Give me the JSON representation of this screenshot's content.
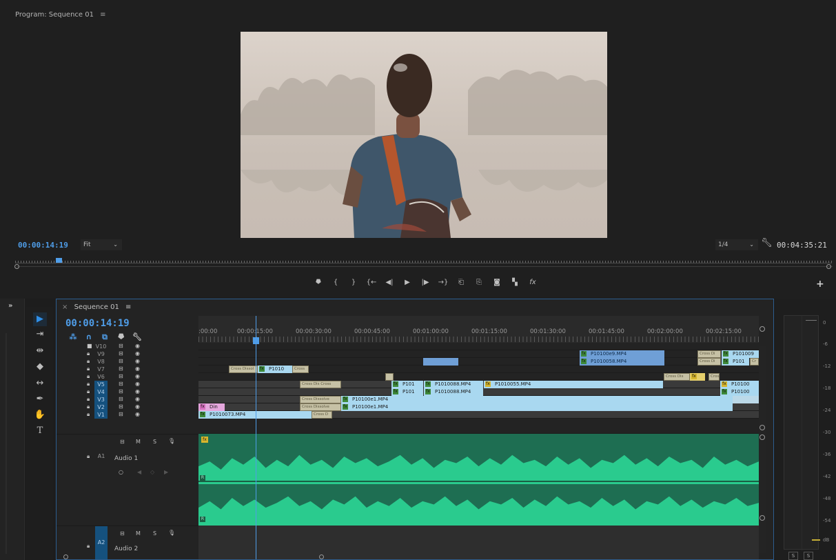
{
  "program": {
    "title": "Program: Sequence 01",
    "menu_icon": "≡",
    "current_timecode": "00:00:14:19",
    "fit": "Fit",
    "resolution": "1/4",
    "duration": "00:04:35:21",
    "transport_icons": [
      "marker-icon",
      "in-icon",
      "out-icon",
      "go-to-in-icon",
      "step-back-icon",
      "play-icon",
      "step-forward-icon",
      "go-to-out-icon",
      "lift-icon",
      "extract-icon",
      "camera-icon",
      "compare-icon",
      "fx-icon"
    ],
    "transport_glyphs": [
      "⯂",
      "{",
      "}",
      "{←",
      "◀|",
      "▶",
      "|▶",
      "→}",
      "⎗",
      "⎘",
      "◙",
      "▚",
      "fx"
    ],
    "add_button": "+"
  },
  "timeline": {
    "tab_close": "×",
    "tab_label": "Sequence 01",
    "tab_menu": "≡",
    "timecode": "00:00:14:19",
    "ruler_labels": [
      ":00:00",
      "00:00:15:00",
      "00:00:30:00",
      "00:00:45:00",
      "00:01:00:00",
      "00:01:15:00",
      "00:01:30:00",
      "00:01:45:00",
      "00:02:00:00",
      "00:02:15:00"
    ],
    "video_tracks": [
      {
        "label": "V10",
        "active": false
      },
      {
        "label": "V9",
        "active": false
      },
      {
        "label": "V8",
        "active": false
      },
      {
        "label": "V7",
        "active": false
      },
      {
        "label": "V6",
        "active": false
      },
      {
        "label": "V5",
        "active": true
      },
      {
        "label": "V4",
        "active": true
      },
      {
        "label": "V3",
        "active": true
      },
      {
        "label": "V2",
        "active": true
      },
      {
        "label": "V1",
        "active": true
      }
    ],
    "clips": {
      "v9_a": "P10100e9.MP4",
      "v9_b": "Cross Di",
      "v9_c": "P101009",
      "v8_a": "P1010058.MP4",
      "v8_b": "Cross Di",
      "v8_c": "P101",
      "v8_d": "Cr",
      "v7_a": "Cross Dissol",
      "v7_b": "P1010",
      "v7_c": "Cross",
      "v6_a": "Cross Dis",
      "v6_b": "Cross",
      "v5_a": "Cross Dis",
      "v5_b": "Cross",
      "v5_c": "P101",
      "v5_d": "P1010088.MP4",
      "v5_e": "P1010055.MP4",
      "v5_f": "P10100",
      "v4_a": "P101",
      "v4_b": "P1010088.MP4",
      "v4_c": "P10100",
      "v3_a": "Cross Dissolve",
      "v3_b": "P10100e1.MP4",
      "v2_a": "Din",
      "v2_b": "Cross Dissolve",
      "v2_c": "P10100e1.MP4",
      "v1_a": "P1010073.MP4",
      "v1_b": "Cross D"
    },
    "audio_tracks": [
      {
        "tag": "A1",
        "name": "Audio 1",
        "m": "M",
        "s": "S"
      },
      {
        "tag": "A2",
        "name": "Audio 2",
        "m": "M",
        "s": "S"
      }
    ],
    "fx_badge": "fx",
    "r_badge": "R"
  },
  "meter": {
    "db_labels": [
      "0",
      "-6",
      "-12",
      "-18",
      "-24",
      "-30",
      "-36",
      "-42",
      "-48",
      "-54",
      "dB"
    ],
    "solo_labels": [
      "S",
      "S"
    ]
  },
  "colors": {
    "accent": "#4f9de8",
    "audio_wave": "#2acb8e",
    "audio_bg": "#1e6e52",
    "clip_light": "#a9d8f0",
    "clip_blue": "#6f9fd6",
    "clip_pink": "#e5a7dd"
  }
}
